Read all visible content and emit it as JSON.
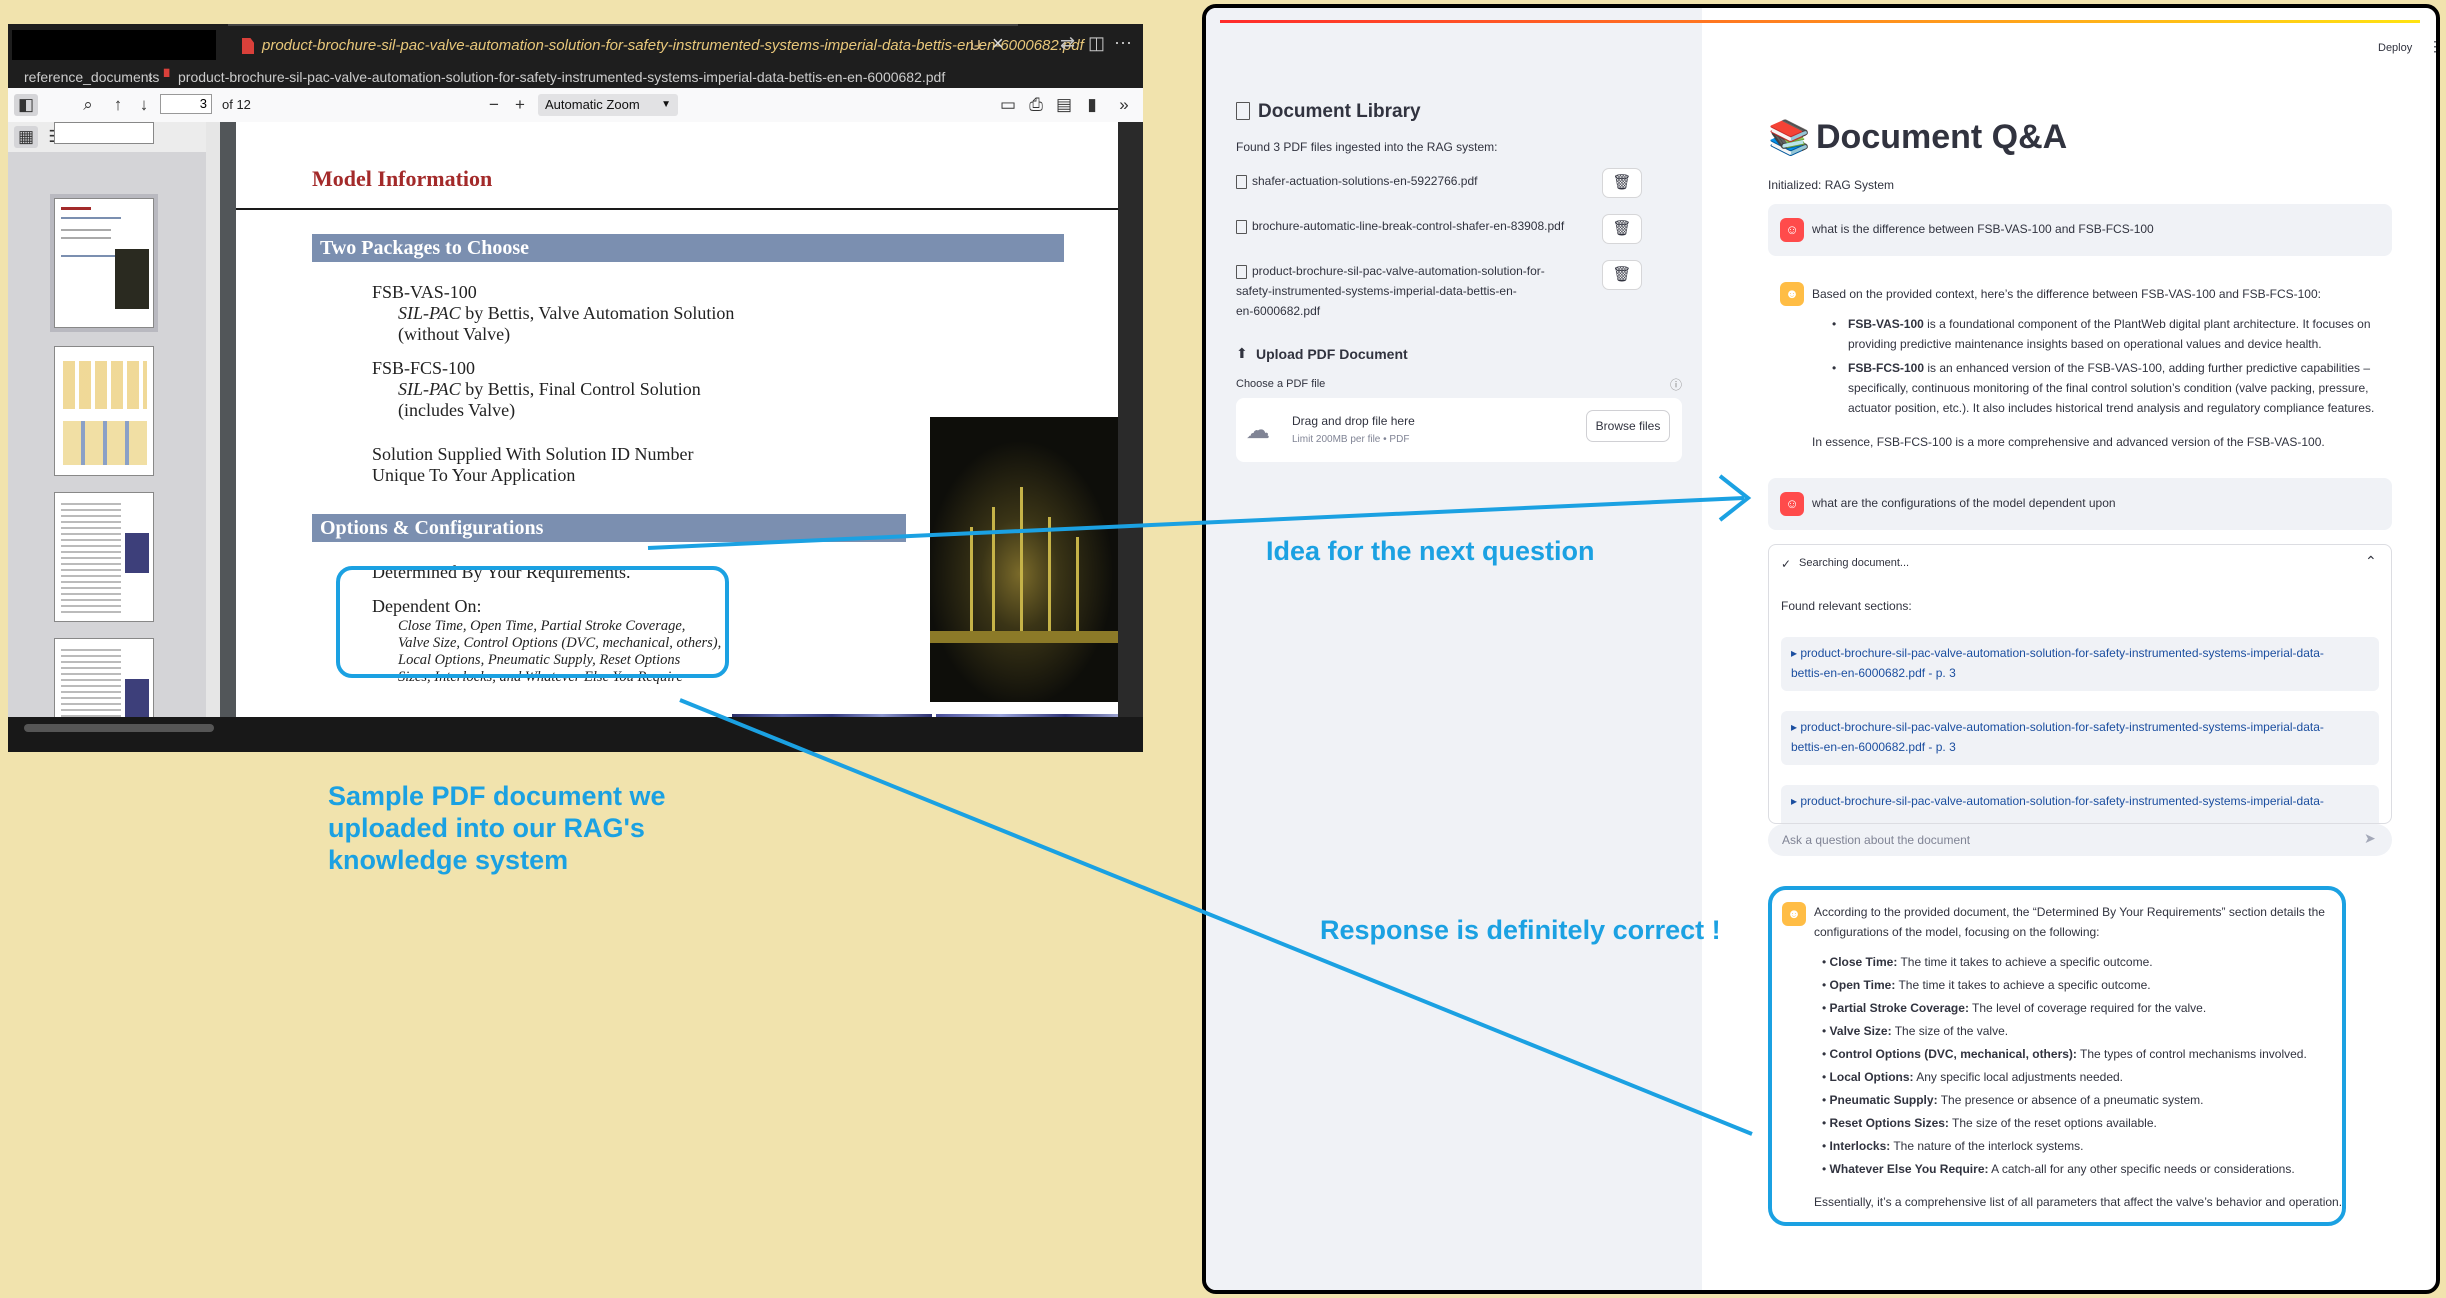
{
  "editor": {
    "tab_title": "product-brochure-sil-pac-valve-automation-solution-for-safety-instrumented-systems-imperial-data-bettis-en-en-6000682.pdf",
    "tab_status": "U",
    "breadcrumb_folder": "reference_documents",
    "breadcrumb_file": "product-brochure-sil-pac-valve-automation-solution-for-safety-instrumented-systems-imperial-data-bettis-en-en-6000682.pdf"
  },
  "pdf_viewer": {
    "page_number": "3",
    "page_count": "of 12",
    "zoom": "Automatic Zoom"
  },
  "pdf_page": {
    "heading": "Model Information",
    "section1": "Two Packages to Choose",
    "pkg1_name": "FSB-VAS-100",
    "pkg1_line1_italic": "SIL-PAC",
    "pkg1_line1_rest": " by Bettis, Valve Automation Solution",
    "pkg1_line2": "(without Valve)",
    "pkg2_name": "FSB-FCS-100",
    "pkg2_line1_italic": "SIL-PAC",
    "pkg2_line1_rest": " by Bettis, Final Control Solution",
    "pkg2_line2": "(includes Valve)",
    "solution_line1": "Solution Supplied With Solution ID Number",
    "solution_line2": "Unique To Your Application",
    "section2": "Options & Configurations",
    "determined": "Determined By Your Requirements.",
    "dependent": "Dependent On:",
    "dep_lines": [
      "Close Time, Open Time, Partial Stroke Coverage,",
      "Valve Size, Control Options (DVC, mechanical, others),",
      "Local Options, Pneumatic Supply, Reset Options",
      "Sizes, Interlocks, and Whatever Else You Require"
    ]
  },
  "sidebar": {
    "title": "Document Library",
    "found_text": "Found 3 PDF files ingested into the RAG system:",
    "files": [
      "shafer-actuation-solutions-en-5922766.pdf",
      "brochure-automatic-line-break-control-shafer-en-83908.pdf",
      [
        "product-brochure-sil-pac-valve-automation-solution-for-",
        "safety-instrumented-systems-imperial-data-bettis-en-",
        "en-6000682.pdf"
      ]
    ],
    "upload_title": "Upload PDF Document",
    "choose_label": "Choose a PDF file",
    "drop_text": "Drag and drop file here",
    "drop_limit": "Limit 200MB per file • PDF",
    "browse_label": "Browse files"
  },
  "main": {
    "deploy_label": "Deploy",
    "title": "Document Q&A",
    "status": "Initialized: RAG System",
    "q1": "what is the difference between FSB-VAS-100 and FSB-FCS-100",
    "a1_intro": "Based on the provided context, here’s the difference between FSB-VAS-100 and FSB-FCS-100:",
    "a1_b1_term": "FSB-VAS-100",
    "a1_b1_l1": " is a foundational component of the PlantWeb digital plant architecture. It focuses on",
    "a1_b1_l2": "providing predictive maintenance insights based on operational values and device health.",
    "a1_b2_term": "FSB-FCS-100",
    "a1_b2_l1": " is an enhanced version of the FSB-VAS-100, adding further predictive capabilities –",
    "a1_b2_l2": "specifically, continuous monitoring of the final control solution’s condition (valve packing, pressure,",
    "a1_b2_l3": "actuator position, etc.). It also includes historical trend analysis and regulatory compliance features.",
    "a1_summary": "In essence, FSB-FCS-100 is a more comprehensive and advanced version of the FSB-VAS-100.",
    "q2": "what are the configurations of the model dependent upon",
    "search_status": "Searching document...",
    "found_sections": "Found relevant sections:",
    "sections": [
      [
        "▸ product-brochure-sil-pac-valve-automation-solution-for-safety-instrumented-systems-imperial-data-",
        "bettis-en-en-6000682.pdf - p. 3"
      ],
      [
        "▸ product-brochure-sil-pac-valve-automation-solution-for-safety-instrumented-systems-imperial-data-",
        "bettis-en-en-6000682.pdf - p. 3"
      ],
      [
        "▸ product-brochure-sil-pac-valve-automation-solution-for-safety-instrumented-systems-imperial-data-",
        ""
      ]
    ],
    "chat_placeholder": "Ask a question about the document",
    "a2_intro_l1": "According to the provided document, the “Determined By Your Requirements” section details the",
    "a2_intro_l2": "configurations of the model, focusing on the following:",
    "a2_items": [
      {
        "term": "Close Time:",
        "desc": " The time it takes to achieve a specific outcome."
      },
      {
        "term": "Open Time:",
        "desc": " The time it takes to achieve a specific outcome."
      },
      {
        "term": "Partial Stroke Coverage:",
        "desc": " The level of coverage required for the valve."
      },
      {
        "term": "Valve Size:",
        "desc": " The size of the valve."
      },
      {
        "term": "Control Options (DVC, mechanical, others):",
        "desc": " The types of control mechanisms involved."
      },
      {
        "term": "Local Options:",
        "desc": " Any specific local adjustments needed."
      },
      {
        "term": "Pneumatic Supply:",
        "desc": " The presence or absence of a pneumatic system."
      },
      {
        "term": "Reset Options Sizes:",
        "desc": " The size of the reset options available."
      },
      {
        "term": "Interlocks:",
        "desc": " The nature of the interlock systems."
      },
      {
        "term": "Whatever Else You Require:",
        "desc": " A catch-all for any other specific needs or considerations."
      }
    ],
    "a2_summary": "Essentially, it’s a comprehensive list of all parameters that affect the valve’s behavior and operation."
  },
  "annotations": {
    "note_pdf": [
      "Sample PDF document we",
      "uploaded into our RAG's",
      "knowledge system"
    ],
    "note_next": "Idea for the next question",
    "note_correct": "Response is definitely correct !",
    "color": "#1ba1e2"
  }
}
